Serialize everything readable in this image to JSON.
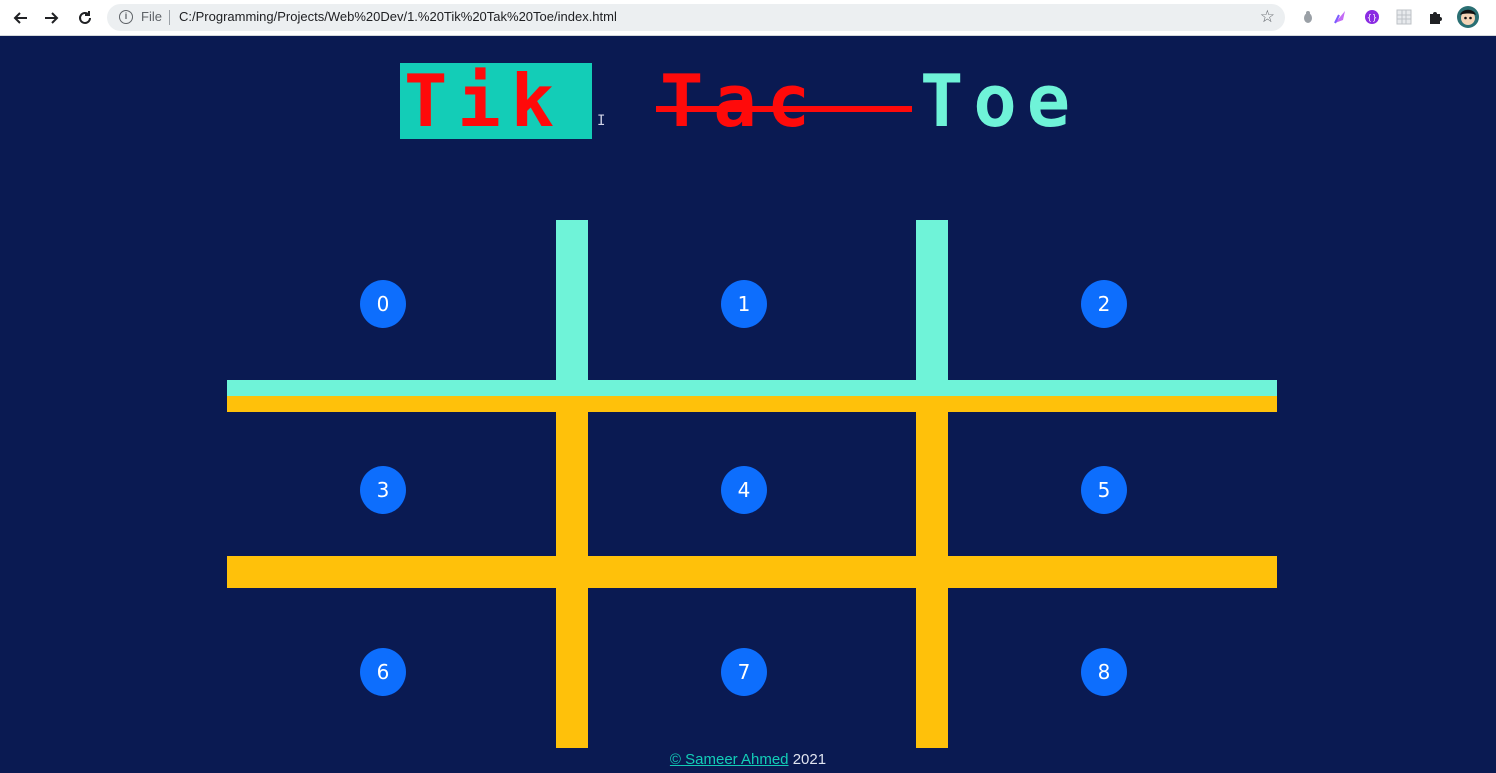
{
  "browser": {
    "scheme_label": "File",
    "url": "C:/Programming/Projects/Web%20Dev/1.%20Tik%20Tak%20Toe/index.html",
    "icons": [
      "back-icon",
      "forward-icon",
      "reload-icon",
      "info-icon",
      "star-icon",
      "bug-icon",
      "feather-icon",
      "ext-purple-icon",
      "ext-grid-icon",
      "puzzle-icon",
      "profile-avatar"
    ]
  },
  "title": {
    "word1": "Tik",
    "word2": "Tac",
    "word3": "Toe"
  },
  "board": {
    "cells": [
      "0",
      "1",
      "2",
      "3",
      "4",
      "5",
      "6",
      "7",
      "8"
    ]
  },
  "footer": {
    "copyright": "©",
    "author": " Sameer Ahmed",
    "year": " 2021"
  },
  "colors": {
    "background": "#0a1a52",
    "teal": "#6ff3d8",
    "gold": "#ffc10a",
    "red": "#ff0a0a",
    "button_blue": "#0d6efd",
    "highlight": "#13cdb7"
  }
}
